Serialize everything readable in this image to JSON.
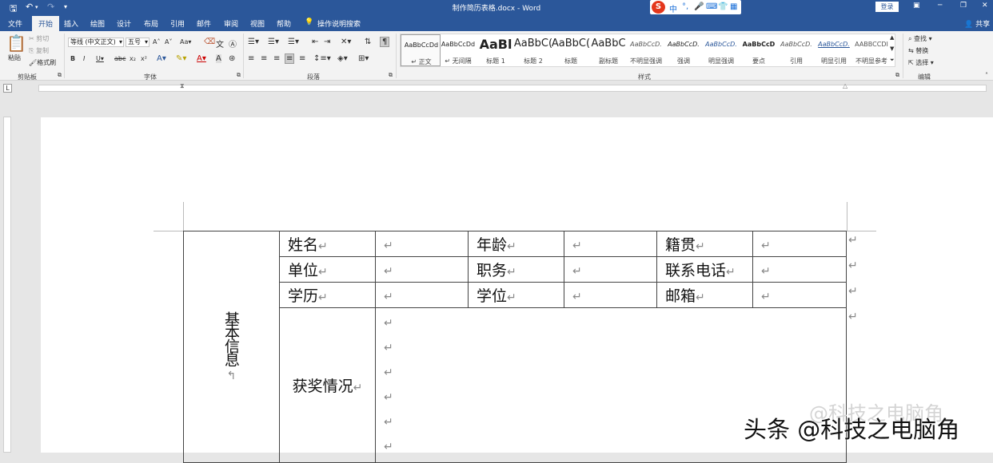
{
  "titlebar": {
    "title": "制作简历表格.docx - Word",
    "login_label": "登录",
    "undo_icon": "undo-icon",
    "sogou": [
      "中",
      "°,",
      "🎤",
      "⌨",
      "👕",
      "▦"
    ]
  },
  "tabs": [
    "文件",
    "开始",
    "插入",
    "绘图",
    "设计",
    "布局",
    "引用",
    "邮件",
    "审阅",
    "视图",
    "帮助"
  ],
  "active_tab": "开始",
  "tell_me": "操作说明搜索",
  "share_label": "共享",
  "ribbon": {
    "clipboard": {
      "paste": "粘贴",
      "cut": "剪切",
      "copy": "复制",
      "format_painter": "格式刷",
      "group": "剪贴板"
    },
    "font": {
      "name": "等线 (中文正文)",
      "size": "五号",
      "group": "字体"
    },
    "paragraph": {
      "group": "段落"
    },
    "styles": {
      "group": "样式",
      "items": [
        {
          "preview": "AaBbCcDd",
          "name": "↵ 正文"
        },
        {
          "preview": "AaBbCcDd",
          "name": "↵ 无间隔"
        },
        {
          "preview": "AaBl",
          "name": "标题 1"
        },
        {
          "preview": "AaBbC(",
          "name": "标题 2"
        },
        {
          "preview": "AaBbC(",
          "name": "标题"
        },
        {
          "preview": "AaBbC",
          "name": "副标题"
        },
        {
          "preview": "AaBbCcD.",
          "name": "不明显强调"
        },
        {
          "preview": "AaBbCcD.",
          "name": "强调"
        },
        {
          "preview": "AaBbCcD.",
          "name": "明显强调"
        },
        {
          "preview": "AaBbCcD",
          "name": "要点"
        },
        {
          "preview": "AaBbCcD.",
          "name": "引用"
        },
        {
          "preview": "AaBbCcD.",
          "name": "明显引用"
        },
        {
          "preview": "AABBCCDI",
          "name": "不明显参考"
        }
      ]
    },
    "editing": {
      "find": "查找",
      "replace": "替换",
      "select": "选择",
      "group": "编辑"
    }
  },
  "table": {
    "side_label": "基本信息",
    "return_mark": "↵",
    "rows": [
      [
        "姓名",
        "",
        "年龄",
        "",
        "籍贯",
        ""
      ],
      [
        "单位",
        "",
        "职务",
        "",
        "联系电话",
        ""
      ],
      [
        "学历",
        "",
        "学位",
        "",
        "邮箱",
        ""
      ]
    ],
    "awards_label": "获奖情况"
  },
  "watermark": "头条 @科技之电脑角",
  "watermark_ghost": "@科技之电脑角"
}
